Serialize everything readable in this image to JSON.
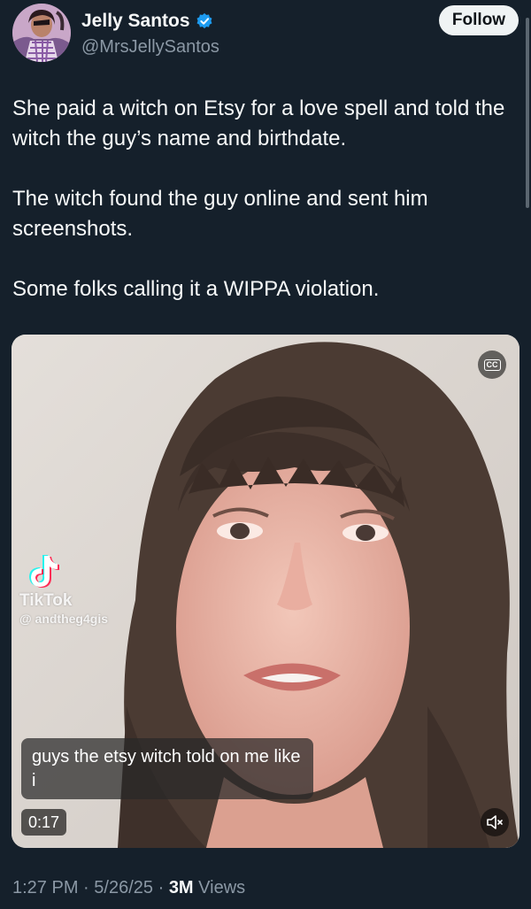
{
  "author": {
    "display_name": "Jelly Santos",
    "handle": "@MrsJellySantos",
    "verified": true,
    "avatar_icon": "profile-photo"
  },
  "follow_label": "Follow",
  "post": {
    "paragraphs": [
      "She paid a witch on Etsy for a love spell and told the witch the guy’s name and birthdate.",
      "The witch found the guy online and sent him screenshots.",
      "Some folks calling it a WIPPA violation."
    ]
  },
  "media": {
    "watermark_brand": "TikTok",
    "watermark_handle": "@ andtheg4gis",
    "caption": "guys the etsy witch told on me like i",
    "duration": "0:17",
    "cc_label": "CC",
    "mute_icon": "speaker-muted-icon"
  },
  "meta": {
    "time": "1:27 PM",
    "date": "5/26/25",
    "separator": "·",
    "views_count": "3M",
    "views_label": "Views"
  },
  "colors": {
    "background": "#15202b",
    "text": "#f7f9f9",
    "secondary_text": "#8b98a5",
    "verified_blue": "#1d9bf0",
    "follow_bg": "#eff3f4"
  }
}
